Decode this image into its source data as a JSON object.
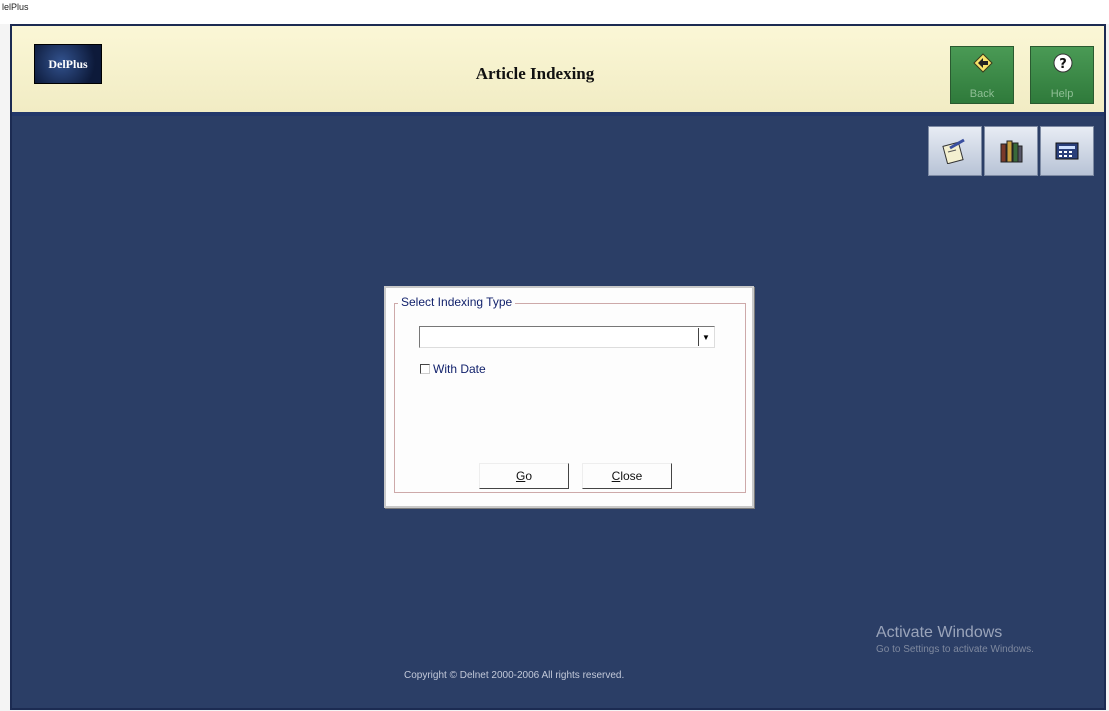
{
  "window": {
    "title": "lelPlus"
  },
  "header": {
    "logo_text": "DelPlus",
    "title": "Article Indexing",
    "back_label": "Back",
    "help_label": "Help"
  },
  "toolbar": {
    "icons": [
      "edit-card-icon",
      "books-icon",
      "calculator-icon"
    ]
  },
  "dialog": {
    "group_label": "Select Indexing Type",
    "indexing_type_value": "",
    "with_date_label": "With Date",
    "with_date_checked": false,
    "go_label": "Go",
    "go_accel": "G",
    "go_rest": "o",
    "close_label": "Close",
    "close_accel": "C",
    "close_rest": "lose"
  },
  "footer": {
    "copyright": "Copyright © Delnet 2000-2006 All rights reserved.",
    "activate_title": "Activate Windows",
    "activate_sub": "Go to Settings to activate Windows."
  },
  "colors": {
    "header_bg": "#f6f2cf",
    "workspace_bg": "#2b3e66",
    "nav_button_green": "#3c8a47",
    "dialog_text": "#0f1f6a"
  }
}
